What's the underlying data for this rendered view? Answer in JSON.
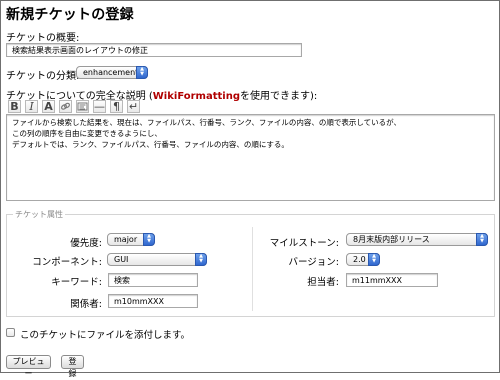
{
  "page_title": "新規チケットの登録",
  "summary": {
    "label": "チケットの概要:",
    "value": "検索結果表示画面のレイアウトの修正"
  },
  "type": {
    "label": "チケットの分類:",
    "selected": "enhancement"
  },
  "description": {
    "label_before": "チケットについての完全な説明 (",
    "wiki_link": "WikiFormatting",
    "label_after": "を使用できます):",
    "lines": [
      "ファイルから検索した結果を、現在は、ファイルパス、行番号、ランク、ファイルの内容、の順で表示しているが、",
      "この列の順序を自由に変更できるようにし、",
      "デフォルトでは、ランク、ファイルパス、行番号、ファイルの内容、の順にする。"
    ]
  },
  "toolbar": {
    "bold": "B",
    "italic": "I",
    "heading": "A",
    "hr": "—",
    "pilcrow": "¶",
    "newline": "↵"
  },
  "properties": {
    "legend": "チケット属性",
    "priority": {
      "label": "優先度:",
      "selected": "major"
    },
    "component": {
      "label": "コンポーネント:",
      "selected": "GUI"
    },
    "keywords": {
      "label": "キーワード:",
      "value": "検索"
    },
    "cc": {
      "label": "関係者:",
      "value": "m10mmXXX"
    },
    "milestone": {
      "label": "マイルストーン:",
      "selected": "8月末版内部リリース"
    },
    "version": {
      "label": "バージョン:",
      "selected": "2.0"
    },
    "owner": {
      "label": "担当者:",
      "value": "m11mmXXX"
    }
  },
  "attachment": {
    "label": "このチケットにファイルを添付します。",
    "checked": false
  },
  "buttons": {
    "preview": "プレビュー",
    "submit": "登録"
  },
  "colors": {
    "accent": "#2f67cf",
    "wiki_link": "#b00000"
  }
}
